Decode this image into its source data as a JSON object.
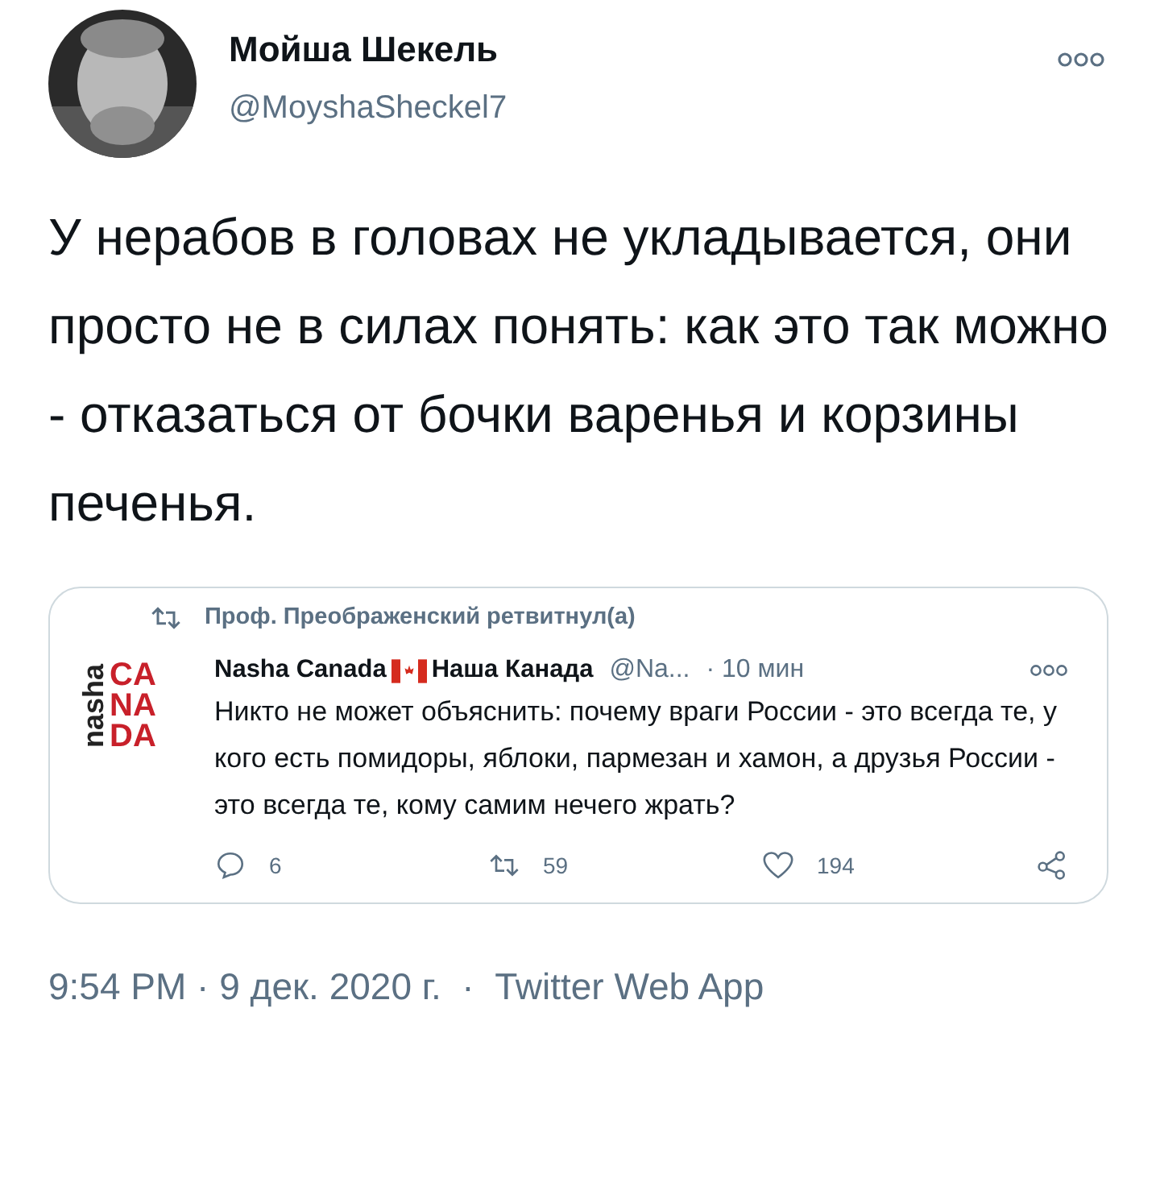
{
  "author": {
    "name": "Мойша Шекель",
    "handle": "@MoyshaSheckel7"
  },
  "text": "У нерабов в головах не укладывается, они просто не в силах понять: как это так можно - отказаться от бочки варенья и корзины печенья.",
  "quote": {
    "retweeted_by": "Проф. Преображенский ретвитнул(а)",
    "logo": {
      "side": "nasha",
      "lines": [
        "CA",
        "NA",
        "DA"
      ]
    },
    "name_parts": [
      "Nasha Canada",
      "Наша Канада"
    ],
    "handle": "@Na...",
    "time": "· 10 мин",
    "text": "Никто не может объяснить: почему враги России - это всегда те, у кого есть помидоры, яблоки, пармезан и хамон, а друзья России - это всегда те, кому самим нечего жрать?",
    "actions": [
      {
        "kind": "reply",
        "count": "6"
      },
      {
        "kind": "retweet",
        "count": "59"
      },
      {
        "kind": "like",
        "count": "194"
      },
      {
        "kind": "share"
      }
    ]
  },
  "footer": "9:54 PM · 9 дек. 2020 г.  ·  Twitter Web App"
}
